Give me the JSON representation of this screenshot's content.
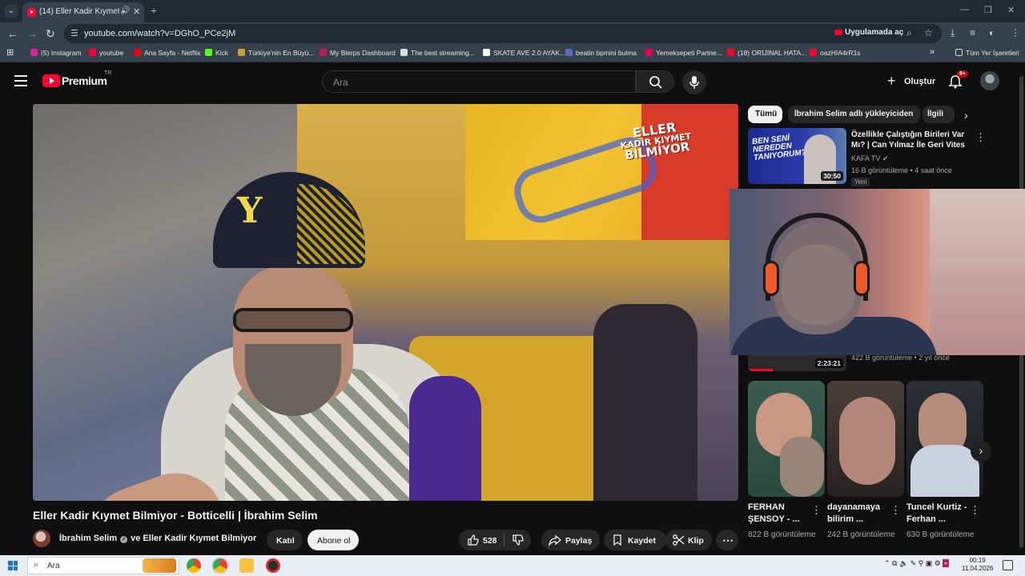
{
  "browser": {
    "tab": {
      "title": "(14) Eller Kadir Kıymet Bilm..."
    },
    "url": "youtube.com/watch?v=DGhO_PCe2jM",
    "open_in_app_label": "Uygulamada aç",
    "bookmarks": [
      {
        "label": "(5) Instagram",
        "color": "#d6249f"
      },
      {
        "label": "youtube",
        "color": "#ff0033"
      },
      {
        "label": "Ana Sayfa - Netflix",
        "color": "#e50914"
      },
      {
        "label": "Kick",
        "color": "#53fc18"
      },
      {
        "label": "Türkiye'nin En Büyü...",
        "color": "#c89b3c"
      },
      {
        "label": "My Blerps Dashboard",
        "color": "#c2185b"
      },
      {
        "label": "The best streaming...",
        "color": "#dddddd"
      },
      {
        "label": "SKATE AVE 2.0 AYAK...",
        "color": "#ffffff"
      },
      {
        "label": "beatin bpmini bulma",
        "color": "#5c6bc0"
      },
      {
        "label": "Yemeksepeti Partne...",
        "color": "#ea004b"
      },
      {
        "label": "(18) ORİJİNAL HATA...",
        "color": "#ff0033"
      },
      {
        "label": "oazHIA4rR1s",
        "color": "#ff0033"
      }
    ],
    "all_bookmarks_label": "Tüm Yer İşaretleri"
  },
  "youtube": {
    "logo_text": "Premium",
    "country": "TR",
    "search_placeholder": "Ara",
    "create_label": "Oluştur",
    "notification_count": "9+"
  },
  "video": {
    "title": "Eller Kadir Kıymet Bilmiyor - Botticelli | İbrahim Selim",
    "overlay_title_lines": [
      "ELLER",
      "KADİR KIYMET",
      "BİLMİYOR"
    ],
    "channel": "İbrahim Selim",
    "collab_channel": "ve Eller Kadir Kıymet Bilmiyor",
    "join_label": "Katıl",
    "subscribe_label": "Abone ol",
    "likes": "528",
    "share_label": "Paylaş",
    "save_label": "Kaydet",
    "clip_label": "Klip"
  },
  "sidebar": {
    "chips": [
      "Tümü",
      "İbrahim Selim adlı yükleyiciden",
      "İlgili"
    ],
    "recommended": [
      {
        "title": "Özellikle Çalıştığın Birileri Var Mı? | Can Yılmaz İle Geri Vites",
        "thumb_text": "BEN SENİ NEREDEN TANIYORUM?",
        "duration": "30:50",
        "channel": "KAFA TV",
        "meta": "16 B görüntüleme • 4 saat önce",
        "badge": "Yeni"
      },
      {
        "duration": "2:23:21",
        "meta": "422 B görüntüleme • 2 yıl önce",
        "watched_fraction": 0.25
      }
    ],
    "shorts": [
      {
        "title": "FERHAN ŞENSOY - ...",
        "views": "822 B görüntüleme"
      },
      {
        "title": "dayanamaya bilirim ...",
        "views": "242 B görüntüleme"
      },
      {
        "title": "Tuncel Kurtiz - Ferhan ...",
        "views": "630 B görüntüleme"
      }
    ]
  },
  "taskbar": {
    "search_placeholder": "Ara",
    "time": "00:19",
    "date": "11.04.2026"
  }
}
